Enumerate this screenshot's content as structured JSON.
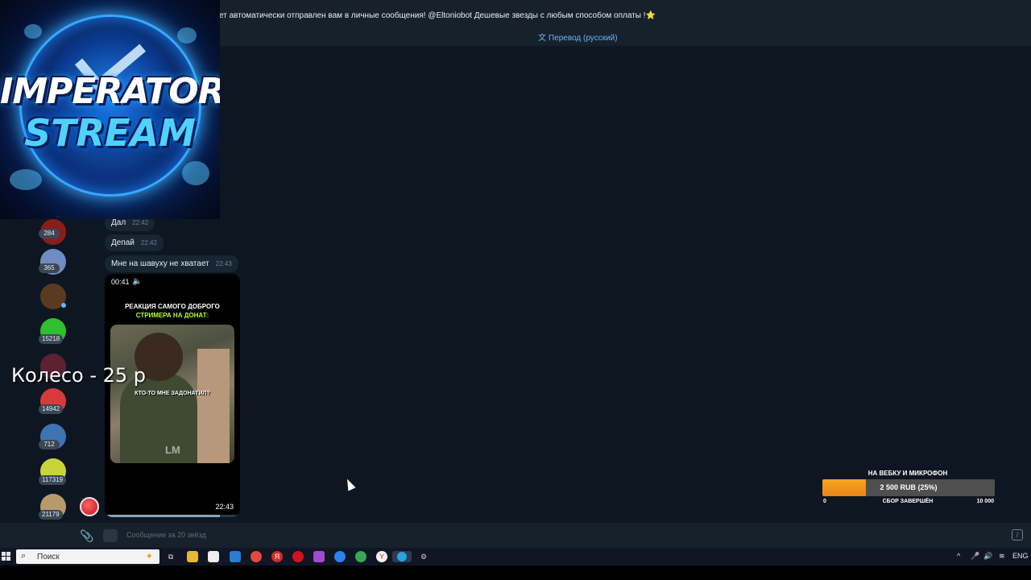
{
  "pinned": {
    "text": "ет автоматически отправлен вам в личные сообщения! @Eltoniobot Дешевые звезды с любым способом оплаты !",
    "star": "⭐",
    "translate_label": "Перевод (русский)"
  },
  "overlay": {
    "logo_line1": "IMPERATOR",
    "logo_line2": "STREAM",
    "wheel_text": "Колесо - 25 р"
  },
  "sidebar": {
    "badges": [
      "284",
      "365",
      "15218",
      "14942",
      "712",
      "117319",
      "21179"
    ]
  },
  "messages": [
    {
      "text": "Дал",
      "time": "22:42"
    },
    {
      "text": "Депай",
      "time": "22:42"
    },
    {
      "text": "Мне на шавуху не хватает",
      "time": "22:43"
    }
  ],
  "video": {
    "duration": "00:41",
    "caption_line1": "РЕАКЦИЯ САМОГО ДОБРОГО",
    "caption_line2": "СТРИМЕРА НА ДОНАТ:",
    "frame_text": "КТО-ТО МНЕ ЗАДОНАТИЛ?",
    "watermark": "LM",
    "time": "22:43",
    "progress": 0.85
  },
  "composer": {
    "placeholder": "Сообщение за 20 звёзд"
  },
  "goal": {
    "title": "НА ВЕБКУ И МИКРОФОН",
    "amount_text": "2 500 RUB (25%)",
    "progress": 0.25,
    "min": "0",
    "status": "СБОР ЗАВЕРШЁН",
    "max": "10 000"
  },
  "taskbar": {
    "search_label": "Поиск",
    "lang": "ENG"
  },
  "colors": {
    "background": "#0e1621",
    "panel": "#17212b",
    "bubble": "#182533",
    "accent": "#6ab3f3",
    "goal_fill": "#f7a51d"
  }
}
